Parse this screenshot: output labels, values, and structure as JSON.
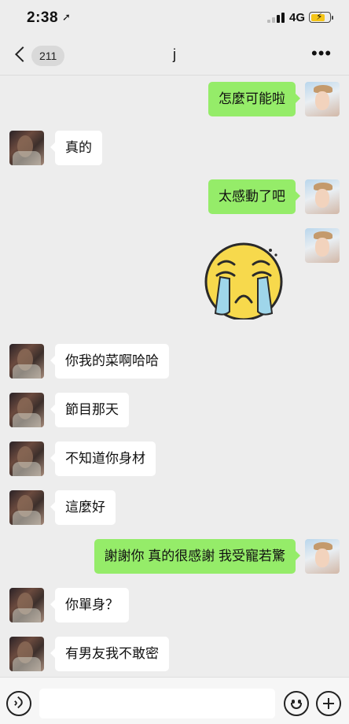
{
  "status_bar": {
    "time": "2:38",
    "network": "4G"
  },
  "nav": {
    "unread_count": "211",
    "title": "j",
    "more_label": "•••"
  },
  "messages": [
    {
      "side": "right",
      "text": "怎麼可能啦"
    },
    {
      "side": "left",
      "text": "真的"
    },
    {
      "side": "right",
      "text": "太感動了吧"
    },
    {
      "side": "right",
      "sticker": "crying-face-sticker"
    },
    {
      "side": "left",
      "text": "你我的菜啊哈哈"
    },
    {
      "side": "left",
      "text": "節目那天"
    },
    {
      "side": "left",
      "text": "不知道你身材"
    },
    {
      "side": "left",
      "text": "這麼好"
    },
    {
      "side": "right",
      "text": "謝謝你 真的很感謝 我受寵若驚"
    },
    {
      "side": "left",
      "text": "你單身？"
    },
    {
      "side": "left",
      "text": "有男友我不敢密"
    }
  ],
  "input_bar": {
    "input_value": "",
    "icons": [
      "voice-icon",
      "emoji-icon",
      "plus-icon"
    ]
  },
  "colors": {
    "background": "#ededed",
    "sent_bubble": "#95ec69",
    "received_bubble": "#ffffff"
  }
}
